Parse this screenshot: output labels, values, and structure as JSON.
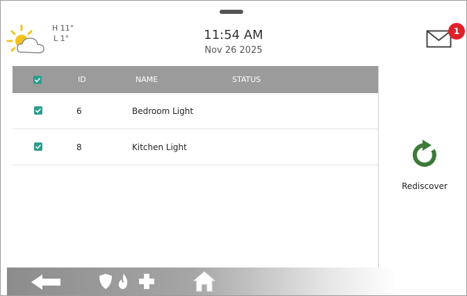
{
  "weather": {
    "high": "H 11°",
    "low": "L 1°",
    "icon": "partly-sunny-icon"
  },
  "clock": {
    "time": "11:54 AM",
    "date": "Nov 26 2025"
  },
  "messages": {
    "icon": "mail-icon",
    "badge_count": "1",
    "badge_color": "#e2202a"
  },
  "table": {
    "columns": {
      "id": "ID",
      "name": "NAME",
      "status": "STATUS"
    },
    "header_checked": true,
    "rows": [
      {
        "checked": true,
        "id": "6",
        "name": "Bedroom Light",
        "status": ""
      },
      {
        "checked": true,
        "id": "8",
        "name": "Kitchen Light",
        "status": ""
      }
    ]
  },
  "actions": {
    "rediscover_label": "Rediscover",
    "rediscover_color": "#3d7a3a"
  },
  "bottom_nav": {
    "items": [
      "back-arrow-icon",
      "shield-icon",
      "fire-icon",
      "medical-cross-icon",
      "home-icon"
    ]
  },
  "colors": {
    "checkbox": "#2a9d8f",
    "table_header": "#9b9b9b"
  }
}
